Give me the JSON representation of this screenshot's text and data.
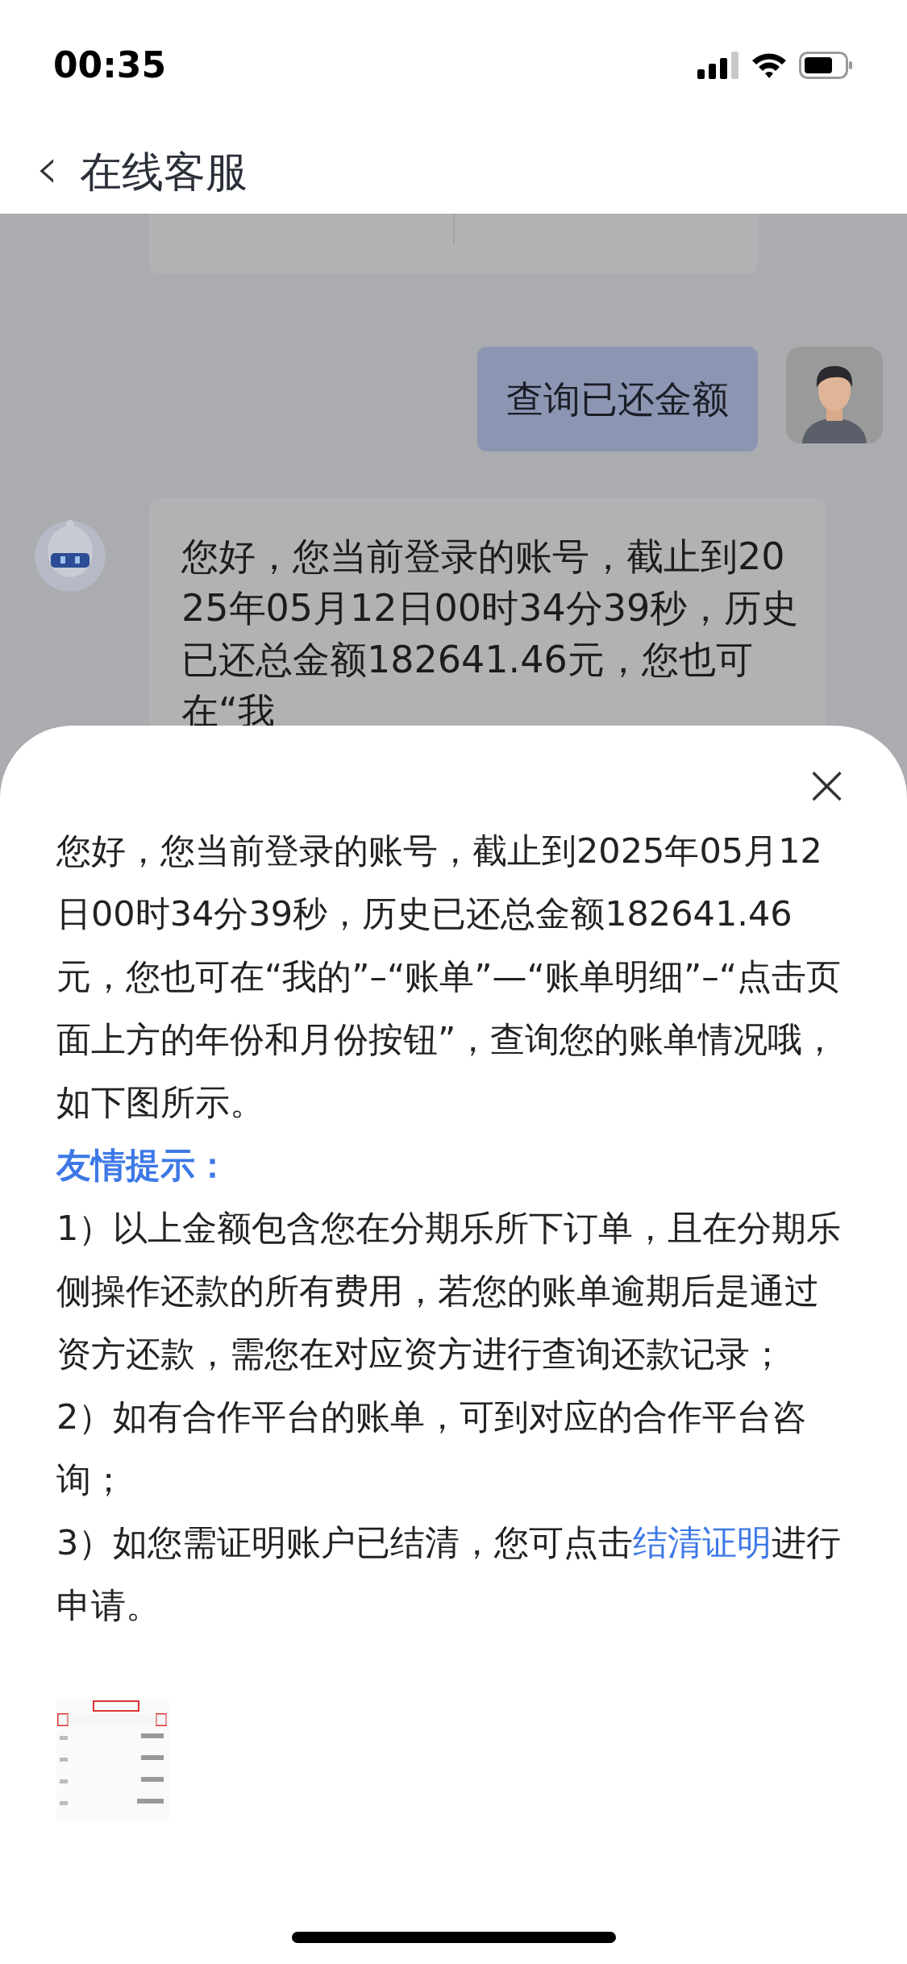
{
  "status_bar": {
    "time": "00:35"
  },
  "header": {
    "back": "‹",
    "title": "在线客服"
  },
  "chat": {
    "messages": [
      {
        "kind": "card"
      },
      {
        "kind": "user",
        "text": "查询已还金额"
      },
      {
        "kind": "bot",
        "text": "您好，您当前登录的账号，截止到2025年05月12日00时34分39秒，历史已还总金额182641.46元，您也可在“我"
      }
    ]
  },
  "sheet": {
    "close": "×",
    "intro": "您好，您当前登录的账号，截止到2025年05月12日00时34分39秒，历史已还总金额182641.46元，您也可在“我的”–“账单”—“账单明细”–“点击页面上方的年份和月份按钮”，查询您的账单情况哦，如下图所示。",
    "tip_title": "友情提示：",
    "tips": [
      {
        "text": "1）以上金额包含您在分期乐所下订单，且在分期乐侧操作还款的所有费用，若您的账单逾期后是通过资方还款，需您在对应资方进行查询还款记录；"
      },
      {
        "text": "2）如有合作平台的账单，可到对应的合作平台咨询；"
      },
      {
        "text": "3）如您需证明账户已结清，您可点击",
        "link": "结清证明",
        "text_after": "进行申请。"
      }
    ]
  }
}
